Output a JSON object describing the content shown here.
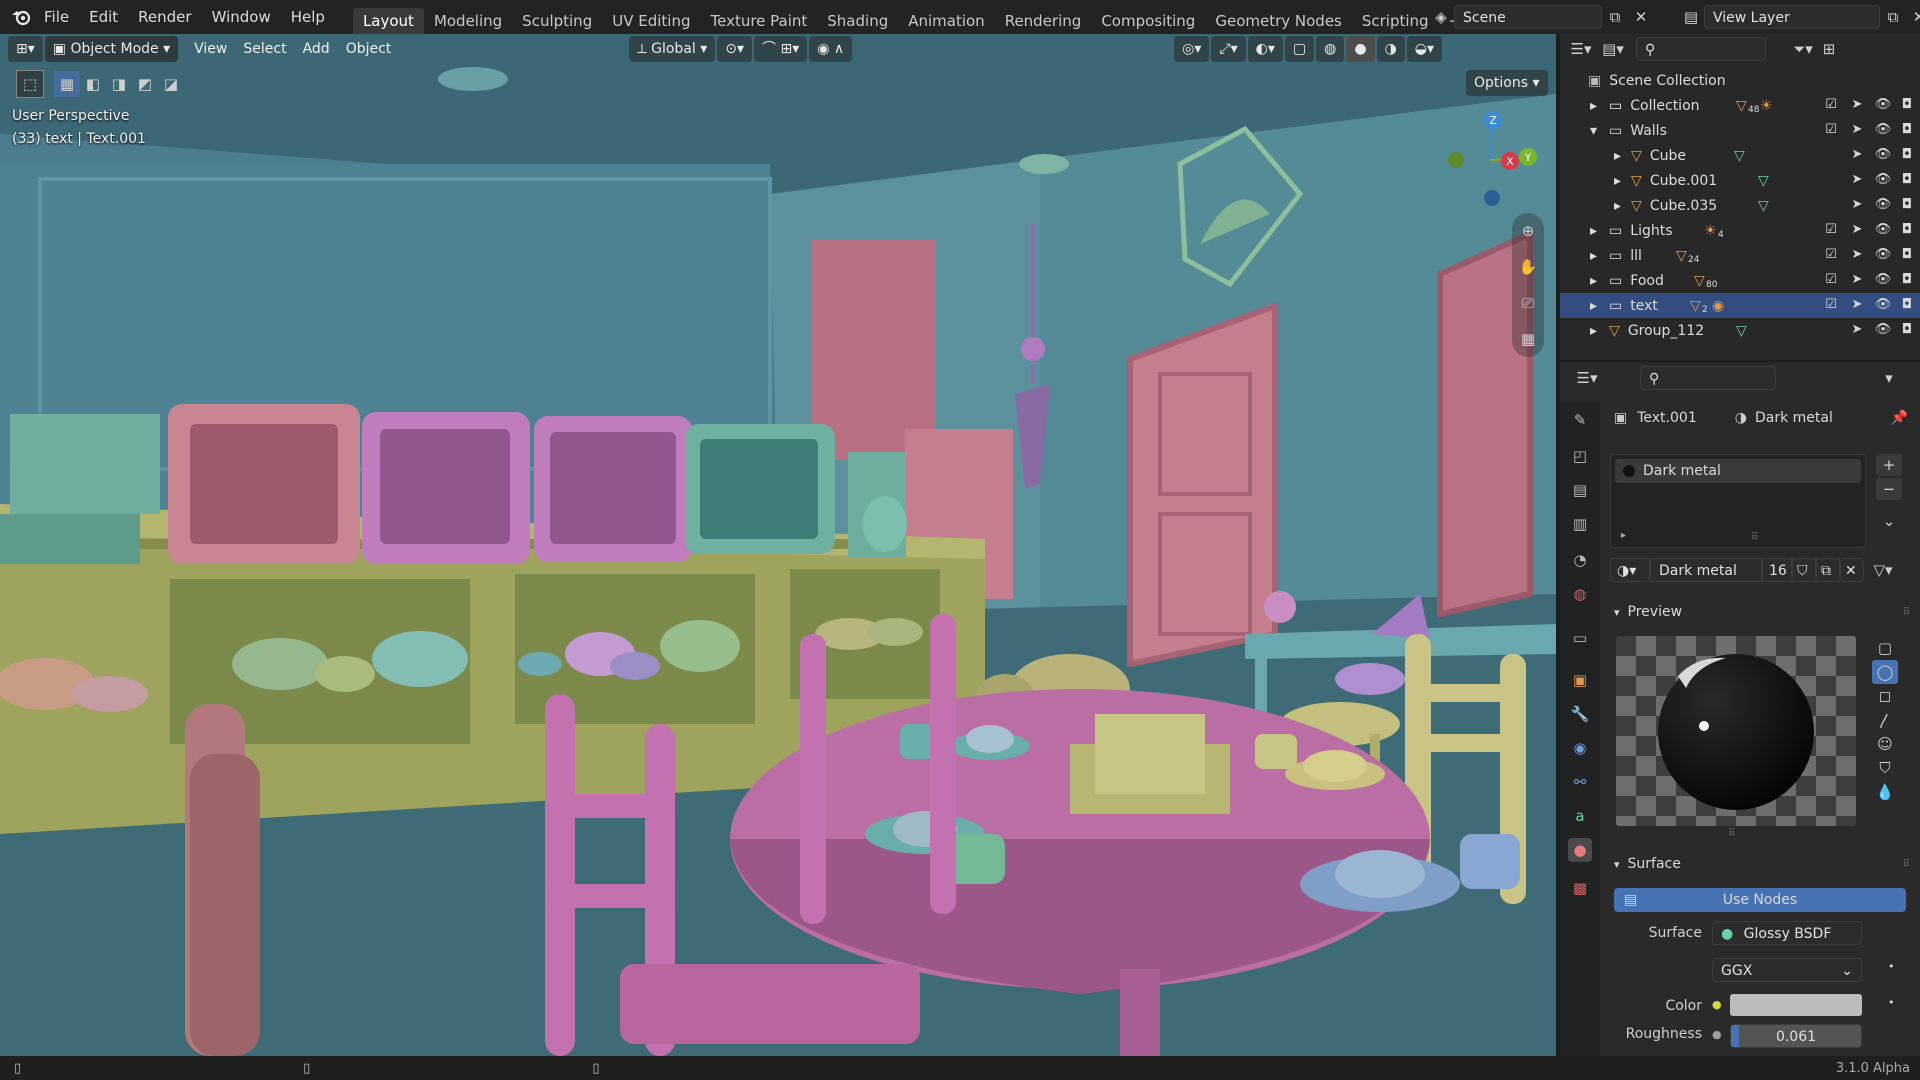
{
  "menu": {
    "file": "File",
    "edit": "Edit",
    "render": "Render",
    "window": "Window",
    "help": "Help"
  },
  "workspaces": [
    "Layout",
    "Modeling",
    "Sculpting",
    "UV Editing",
    "Texture Paint",
    "Shading",
    "Animation",
    "Rendering",
    "Compositing",
    "Geometry Nodes",
    "Scripting"
  ],
  "scene": {
    "name": "Scene",
    "view_layer": "View Layer"
  },
  "viewport": {
    "mode": "Object Mode",
    "view": "View",
    "select": "Select",
    "add": "Add",
    "object": "Object",
    "orientation": "Global",
    "options": "Options",
    "perspective": "User Perspective",
    "info": "(33) text | Text.001",
    "gizmo": {
      "x": "X",
      "y": "Y",
      "z": "Z"
    }
  },
  "outliner": {
    "root": "Scene Collection",
    "rows": [
      {
        "label": "Collection",
        "badge": "48"
      },
      {
        "label": "Walls",
        "badge": ""
      },
      {
        "label": "Cube",
        "badge": ""
      },
      {
        "label": "Cube.001",
        "badge": ""
      },
      {
        "label": "Cube.035",
        "badge": ""
      },
      {
        "label": "Lights",
        "badge": "4"
      },
      {
        "label": "lll",
        "badge": "24"
      },
      {
        "label": "Food",
        "badge": "80"
      },
      {
        "label": "text",
        "badge": "2"
      },
      {
        "label": "Group_112",
        "badge": ""
      }
    ]
  },
  "properties": {
    "object": "Text.001",
    "material": "Dark metal",
    "slot": "Dark metal",
    "datablock": "Dark metal",
    "users": "16",
    "preview_label": "Preview",
    "surface_section": "Surface",
    "use_nodes": "Use Nodes",
    "surface_label": "Surface",
    "surface_value": "Glossy BSDF",
    "distribution": "GGX",
    "color_label": "Color",
    "roughness_label": "Roughness",
    "roughness_value": "0.061"
  },
  "status": {
    "version": "3.1.0 Alpha"
  },
  "colors": {
    "accent": "#4772b3",
    "selected_row": "#334d80",
    "wall": "#4f8394"
  }
}
